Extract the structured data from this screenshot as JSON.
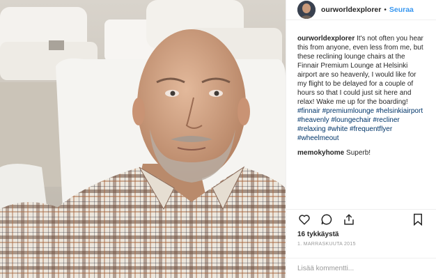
{
  "header": {
    "username": "ourworldexplorer",
    "separator": "•",
    "follow_label": "Seuraa"
  },
  "caption": {
    "username": "ourworldexplorer",
    "text": "It's not often you hear this from anyone, even less from me, but these reclining lounge chairs at the Finnair Premium Lounge at Helsinki airport are so heavenly, I would like for my flight to be delayed for a couple of hours so that I could just sit here and relax! Wake me up for the boarding!",
    "hashtags": "#finnair #premiumlounge #helsinkiairport #heavenly #loungechair #recliner #relaxing #white #frequentflyer #wheelmeout"
  },
  "comments": [
    {
      "username": "memokyhome",
      "text": "Superb!"
    }
  ],
  "actions": {
    "like_icon": "heart-icon",
    "comment_icon": "comment-icon",
    "share_icon": "share-icon",
    "save_icon": "bookmark-icon"
  },
  "likes": "16 tykkäystä",
  "date": "1. MARRASKUUTA 2015",
  "add_comment": {
    "placeholder": "Lisää kommentti..."
  },
  "colors": {
    "link": "#3897f0",
    "hashtag": "#003569",
    "muted": "#999999",
    "text": "#262626",
    "divider": "#efefef"
  }
}
